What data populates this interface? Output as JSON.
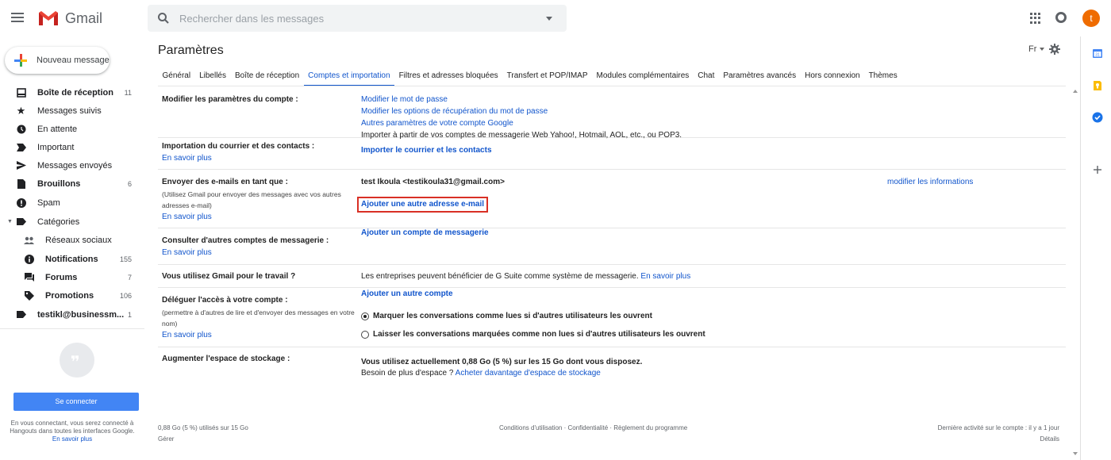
{
  "app": {
    "name": "Gmail"
  },
  "search": {
    "placeholder": "Rechercher dans les messages"
  },
  "account": {
    "avatar_letter": "t",
    "avatar_color": "#ef6c00"
  },
  "compose": {
    "label": "Nouveau message"
  },
  "sidebar": {
    "items": [
      {
        "label": "Boîte de réception",
        "count": "11",
        "bold": true,
        "icon": "inbox-icon"
      },
      {
        "label": "Messages suivis",
        "count": "",
        "bold": false,
        "icon": "star-icon"
      },
      {
        "label": "En attente",
        "count": "",
        "bold": false,
        "icon": "clock-icon"
      },
      {
        "label": "Important",
        "count": "",
        "bold": false,
        "icon": "important-icon"
      },
      {
        "label": "Messages envoyés",
        "count": "",
        "bold": false,
        "icon": "send-icon"
      },
      {
        "label": "Brouillons",
        "count": "6",
        "bold": true,
        "icon": "draft-icon"
      },
      {
        "label": "Spam",
        "count": "",
        "bold": false,
        "icon": "spam-icon"
      },
      {
        "label": "Catégories",
        "count": "",
        "bold": false,
        "icon": "label-icon"
      },
      {
        "label": "Réseaux sociaux",
        "count": "",
        "bold": false,
        "icon": "people-icon"
      },
      {
        "label": "Notifications",
        "count": "155",
        "bold": true,
        "icon": "info-icon"
      },
      {
        "label": "Forums",
        "count": "7",
        "bold": true,
        "icon": "forum-icon"
      },
      {
        "label": "Promotions",
        "count": "106",
        "bold": true,
        "icon": "tag-icon"
      },
      {
        "label": "testikl@businessm...",
        "count": "1",
        "bold": true,
        "icon": "label-icon"
      }
    ]
  },
  "hangouts": {
    "signin_label": "Se connecter",
    "text": "En vous connectant, vous serez connecté à Hangouts dans toutes les interfaces Google.",
    "learn_more": "En savoir plus"
  },
  "settings": {
    "title": "Paramètres",
    "lang": "Fr",
    "tabs": [
      {
        "label": "Général",
        "active": false
      },
      {
        "label": "Libellés",
        "active": false
      },
      {
        "label": "Boîte de réception",
        "active": false
      },
      {
        "label": "Comptes et importation",
        "active": true
      },
      {
        "label": "Filtres et adresses bloquées",
        "active": false
      },
      {
        "label": "Transfert et POP/IMAP",
        "active": false
      },
      {
        "label": "Modules complémentaires",
        "active": false
      },
      {
        "label": "Chat",
        "active": false
      },
      {
        "label": "Paramètres avancés",
        "active": false
      },
      {
        "label": "Hors connexion",
        "active": false
      },
      {
        "label": "Thèmes",
        "active": false
      }
    ],
    "rows": {
      "account": {
        "label": "Modifier les paramètres du compte :",
        "links": [
          "Modifier le mot de passe",
          "Modifier les options de récupération du mot de passe",
          "Autres paramètres de votre compte Google"
        ]
      },
      "import": {
        "label": "Importation du courrier et des contacts :",
        "learn_more": "En savoir plus",
        "desc": "Importer à partir de vos comptes de messagerie Web Yahoo!, Hotmail, AOL, etc., ou POP3.",
        "action": "Importer le courrier et les contacts"
      },
      "send_as": {
        "label": "Envoyer des e-mails en tant que :",
        "desc": "(Utilisez Gmail pour envoyer des messages avec vos autres adresses e-mail)",
        "learn_more": "En savoir plus",
        "address": "test Ikoula <testikoula31@gmail.com>",
        "edit": "modifier les informations",
        "add": "Ajouter une autre adresse e-mail"
      },
      "other_accounts": {
        "label": "Consulter d'autres comptes de messagerie :",
        "learn_more": "En savoir plus",
        "action": "Ajouter un compte de messagerie"
      },
      "work": {
        "label": "Vous utilisez Gmail pour le travail ?",
        "desc": "Les entreprises peuvent bénéficier de G Suite comme système de messagerie.",
        "learn_more": "En savoir plus"
      },
      "delegate": {
        "label": "Déléguer l'accès à votre compte :",
        "desc": "(permettre à d'autres de lire et d'envoyer des messages en votre nom)",
        "learn_more": "En savoir plus",
        "action": "Ajouter un autre compte",
        "option_read": "Marquer les conversations comme lues si d'autres utilisateurs les ouvrent",
        "option_unread": "Laisser les conversations marquées comme non lues si d'autres utilisateurs les ouvrent",
        "selected": "option_read"
      },
      "storage": {
        "label": "Augmenter l'espace de stockage :",
        "usage": "Vous utilisez actuellement 0,88 Go (5 %) sur les 15 Go dont vous disposez.",
        "need_more": "Besoin de plus d'espace ?",
        "buy": "Acheter davantage d'espace de stockage"
      }
    }
  },
  "footer": {
    "storage": "0,88 Go (5 %) utilisés sur 15 Go",
    "manage": "Gérer",
    "links": "Conditions d'utilisation · Confidentialité · Règlement du programme",
    "activity": "Dernière activité sur le compte : il y a 1 jour",
    "details": "Détails"
  }
}
